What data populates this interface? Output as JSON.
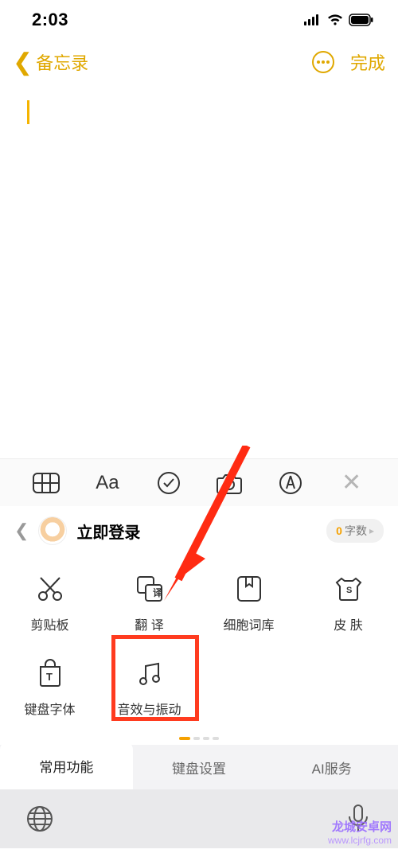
{
  "status": {
    "time": "2:03"
  },
  "nav": {
    "back": "备忘录",
    "done": "完成"
  },
  "login": {
    "prompt": "立即登录"
  },
  "word_count": {
    "value": "0",
    "label": "字数"
  },
  "grid": {
    "items": [
      {
        "label": "剪贴板",
        "icon": "scissors-icon"
      },
      {
        "label": "翻 译",
        "icon": "translate-icon"
      },
      {
        "label": "细胞词库",
        "icon": "bookmark-icon"
      },
      {
        "label": "皮 肤",
        "icon": "shirt-icon"
      },
      {
        "label": "键盘字体",
        "icon": "font-bag-icon"
      },
      {
        "label": "音效与振动",
        "icon": "music-icon"
      }
    ]
  },
  "tabs": {
    "items": [
      "常用功能",
      "键盘设置",
      "AI服务"
    ],
    "active": 0
  },
  "watermark": {
    "line1": "龙城安卓网",
    "line2": "www.lcjrfg.com"
  }
}
